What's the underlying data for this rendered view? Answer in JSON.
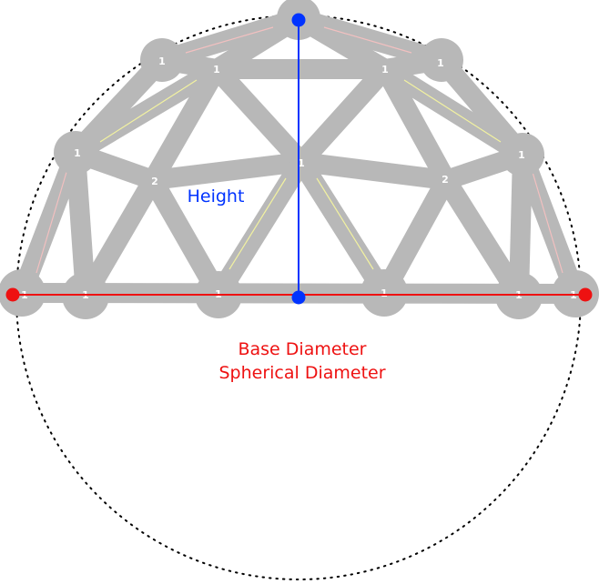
{
  "labels": {
    "height": "Height",
    "base_diameter": "Base Diameter",
    "spherical_diameter": "Spherical Diameter"
  },
  "node_labels": {
    "apex": "",
    "upper_left_outer": "1",
    "upper_left_inner": "1",
    "upper_right_inner": "1",
    "upper_right_outer": "1",
    "mid_left_outer": "1",
    "mid_left_inner": "2",
    "center": "1",
    "mid_right_inner": "2",
    "mid_right_outer": "1",
    "base_far_left": "1",
    "base_left": "1",
    "base_left_center": "1",
    "base_right_center": "1",
    "base_right": "1",
    "base_far_right": "1"
  },
  "colors": {
    "strut": "#b8b8b8",
    "height_line": "#0033ff",
    "base_line": "#ee1111",
    "sphere_outline": "#000000",
    "node_number": "#ffffff",
    "strut_highlight_yellow": "#f2f2a0",
    "strut_highlight_pink": "#f2c0c0"
  }
}
